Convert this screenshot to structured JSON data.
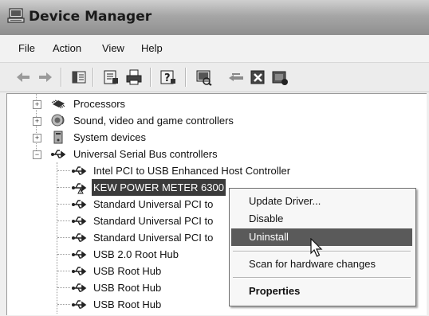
{
  "window": {
    "title": "Device Manager"
  },
  "menu": [
    "File",
    "Action",
    "View",
    "Help"
  ],
  "toolbar": {
    "buttons": [
      "back-icon",
      "forward-icon",
      "console-tree-icon",
      "properties-icon",
      "print-icon",
      "help-icon",
      "scan-hardware-icon",
      "update-driver-icon",
      "uninstall-icon",
      "disable-icon"
    ]
  },
  "tree": {
    "categories": [
      {
        "label": "Processors",
        "expander": "+"
      },
      {
        "label": "Sound, video and game controllers",
        "expander": "+"
      },
      {
        "label": "System devices",
        "expander": "+"
      },
      {
        "label": "Universal Serial Bus controllers",
        "expander": "−"
      }
    ],
    "usb_devices": [
      "Intel PCI to USB Enhanced Host Controller",
      "KEW POWER METER 6300",
      "Standard Universal PCI to",
      "Standard Universal PCI to",
      "Standard Universal PCI to",
      "USB 2.0 Root Hub",
      "USB Root Hub",
      "USB Root Hub",
      "USB Root Hub"
    ]
  },
  "context_menu": {
    "update_driver": "Update Driver...",
    "disable": "Disable",
    "uninstall": "Uninstall",
    "scan": "Scan for hardware changes",
    "properties": "Properties"
  }
}
